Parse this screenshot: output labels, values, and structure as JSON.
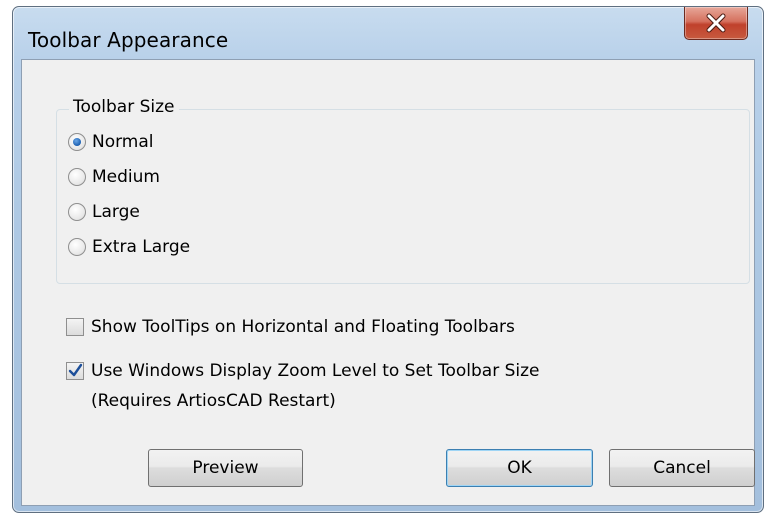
{
  "window": {
    "title": "Toolbar Appearance",
    "close_icon": "close-x-icon"
  },
  "toolbar_size": {
    "group_label": "Toolbar Size",
    "options": [
      {
        "label": "Normal",
        "checked": true
      },
      {
        "label": "Medium",
        "checked": false
      },
      {
        "label": "Large",
        "checked": false
      },
      {
        "label": "Extra Large",
        "checked": false
      }
    ]
  },
  "options": {
    "show_tooltips": {
      "label": "Show ToolTips on Horizontal and Floating Toolbars",
      "checked": false
    },
    "use_zoom": {
      "label": "Use Windows Display Zoom Level to Set Toolbar Size",
      "note": "(Requires ArtiosCAD Restart)",
      "checked": true
    }
  },
  "buttons": {
    "preview": "Preview",
    "ok": "OK",
    "cancel": "Cancel"
  },
  "colors": {
    "close_button": "#c0412c",
    "radio_dot": "#1b5fb0",
    "frame": "#aec9e4"
  }
}
